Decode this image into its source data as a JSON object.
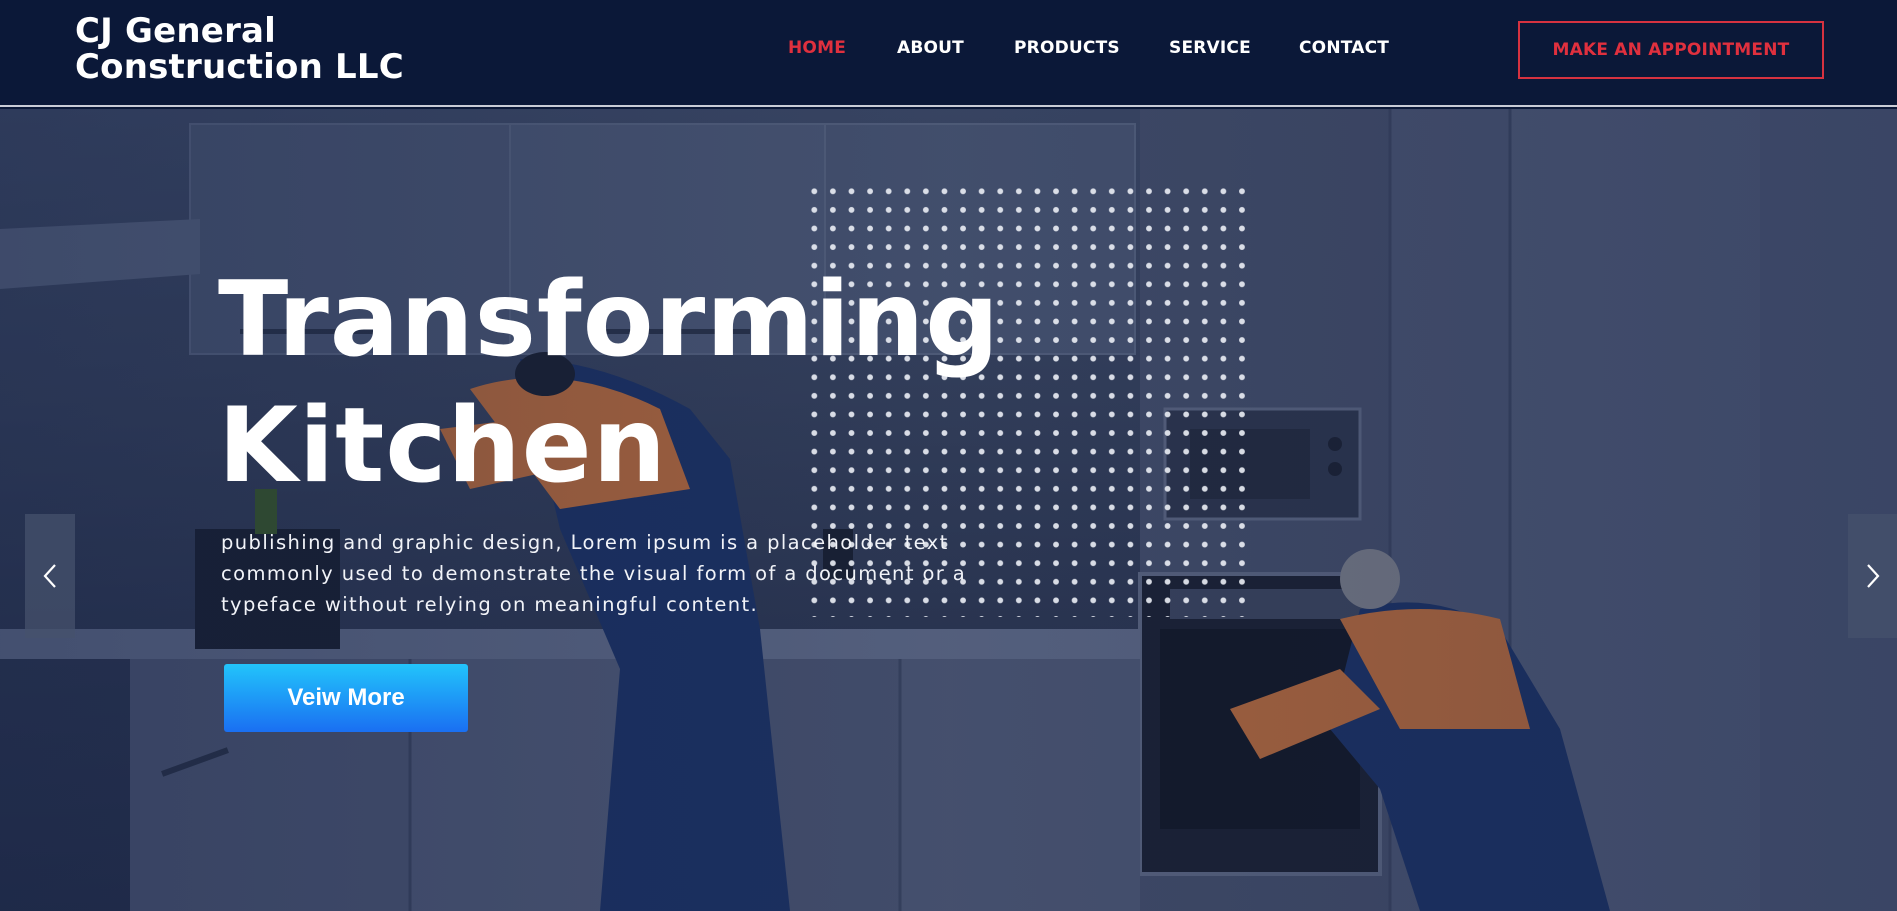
{
  "brand": {
    "line1": "CJ General",
    "line2": "Construction LLC"
  },
  "nav": {
    "items": [
      {
        "label": "HOME",
        "active": true
      },
      {
        "label": "ABOUT",
        "active": false
      },
      {
        "label": "PRODUCTS",
        "active": false
      },
      {
        "label": "SERVICE",
        "active": false
      },
      {
        "label": "CONTACT",
        "active": false
      }
    ],
    "cta_label": "MAKE AN APPOINTMENT"
  },
  "hero": {
    "title_line1": "Transforming",
    "title_line2": "Kitchen",
    "description": "publishing and graphic design, Lorem ipsum is a placeholder text commonly used to demonstrate the visual form of a document or a typeface without relying on meaningful content.",
    "button_label": "Veiw More",
    "prev_icon": "chevron-left-icon",
    "next_icon": "chevron-right-icon",
    "background_image": "two technicians repairing kitchen cabinets and oven"
  },
  "colors": {
    "header_bg": "#0b1838",
    "accent_red": "#e0303e",
    "button_gradient_top": "#22c4fb",
    "button_gradient_bottom": "#1a6ff2"
  }
}
